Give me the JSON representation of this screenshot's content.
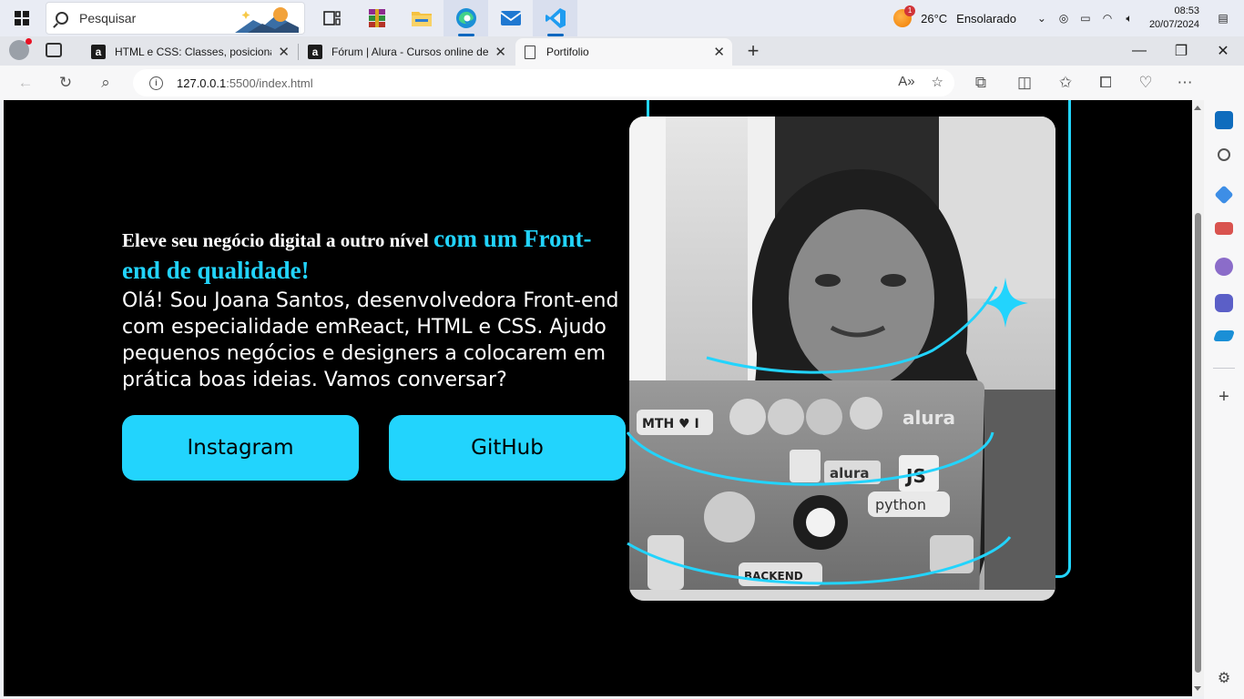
{
  "taskbar": {
    "search_placeholder": "Pesquisar",
    "weather_temp": "26°C",
    "weather_desc": "Ensolarado",
    "weather_badge": "1",
    "time": "08:53",
    "date": "20/07/2024",
    "apps": [
      "task-view",
      "winrar",
      "file-explorer",
      "edge",
      "mail",
      "vscode"
    ]
  },
  "browser": {
    "tabs": [
      {
        "title": "HTML e CSS: Classes, posicionam",
        "favicon": "a"
      },
      {
        "title": "Fórum | Alura - Cursos online de",
        "favicon": "a"
      },
      {
        "title": "Portifolio",
        "favicon": ""
      }
    ],
    "url_host": "127.0.0.1",
    "url_rest": ":5500/index.html"
  },
  "page": {
    "headline_plain": "Eleve seu negócio digital a outro nível ",
    "headline_highlight": "com um Front-end de qualidade!",
    "intro": "Olá! Sou Joana Santos, desenvolvedora Front-end com especialidade emReact, HTML e CSS. Ajudo pequenos negócios e designers a colocarem em prática boas ideias. Vamos conversar?",
    "buttons": {
      "instagram": "Instagram",
      "github": "GitHub"
    },
    "photo_stickers": {
      "tag1": "MTH ♥ I",
      "tag2": "alura",
      "tag3": "JS",
      "tag4": "python",
      "tag5": "BACKEND",
      "tag6": "alura"
    },
    "accent": "#22d4fd"
  }
}
